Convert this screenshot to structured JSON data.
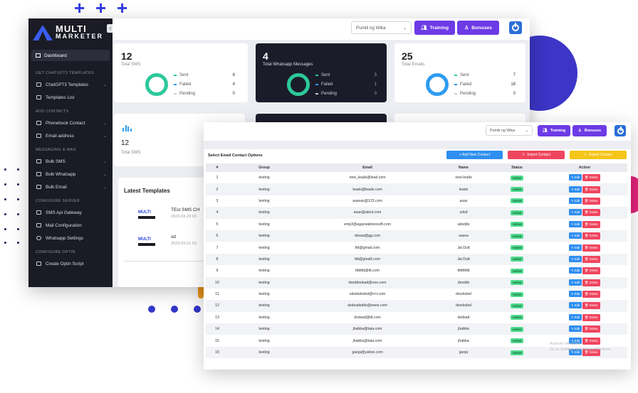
{
  "colors": {
    "accent": "#6d3be6",
    "sidebar": "#1a1b25",
    "success": "#2cc99a",
    "info": "#2d9cf0",
    "danger": "#f0455e",
    "warning": "#f5c518"
  },
  "brand": {
    "line1": "MULTI",
    "line2": "MARKETER"
  },
  "sidebar": {
    "active": "Dashboard",
    "sections": [
      {
        "title": "GET CHATGPT3 TEMPLATES",
        "items": [
          "ChatGPT3 Templates",
          "Templates List"
        ]
      },
      {
        "title": "ADD CONTACTS",
        "items": [
          "Phonebook Contact",
          "Email address"
        ]
      },
      {
        "title": "MESSAGING & MAIL",
        "items": [
          "Bulk SMS",
          "Bulk Whatsapp",
          "Bulk Email"
        ]
      },
      {
        "title": "CONFIGURE SERVER",
        "items": [
          "SMS Api Gateway",
          "Mail Configuration",
          "Whatsapp Settings"
        ]
      },
      {
        "title": "CONFIGURE OPTIN",
        "items": [
          "Create Optin Script"
        ]
      }
    ]
  },
  "header": {
    "language": "Pumili ng Wika",
    "training": "Training",
    "bonuses": "Bonuses"
  },
  "cards": [
    {
      "value": "12",
      "label": "Total SMS",
      "sent": "8",
      "failed": "4",
      "pending": "0"
    },
    {
      "value": "4",
      "label": "Total Whatsapp Messages",
      "sent": "3",
      "failed": "1",
      "pending": "0"
    },
    {
      "value": "25",
      "label": "Total Emails",
      "sent": "7",
      "failed": "18",
      "pending": "0"
    }
  ],
  "stat_labels": {
    "sent": "Sent",
    "failed": "Failed",
    "pending": "Pending"
  },
  "second_row": {
    "value": "12",
    "label": "Total SMS"
  },
  "latest": {
    "title": "Latest Templates",
    "items": [
      {
        "thumb": "MULTI",
        "name": "TEst SMS CH",
        "date": "2023-03-23 03"
      },
      {
        "thumb": "MULTI",
        "name": "sd",
        "date": "2023-03-21 03"
      }
    ]
  },
  "contacts": {
    "title": "Select Email Contact Options",
    "add": "+ Add New Contact",
    "import": "Import Contact",
    "export": "Export Contact",
    "columns": [
      "#",
      "Group",
      "Email",
      "Name",
      "Status",
      "Action"
    ],
    "status": "Active",
    "edit": "Edit",
    "delete": "Delete",
    "rows": [
      [
        "1",
        "testing",
        "new_leads@lead.com",
        "new leads"
      ],
      [
        "2",
        "testing",
        "leads@leads.com",
        "leads"
      ],
      [
        "3",
        "testing",
        "asasas@123.com",
        "asas"
      ],
      [
        "4",
        "testing",
        "asas@abcd.com",
        "sdsd"
      ],
      [
        "5",
        "testing",
        "emp3@agarwalinnosoft.com",
        "adsdds"
      ],
      [
        "6",
        "testing",
        "dssaa@gg.com",
        "sassa"
      ],
      [
        "7",
        "testing",
        "tttt@gmail.com",
        "Jai Dutt"
      ],
      [
        "8",
        "testing",
        "tttt@gmaill.com",
        "Jai Dutt"
      ],
      [
        "9",
        "testing",
        "ttttttttt@ttt.com",
        "tttttttttttt"
      ],
      [
        "10",
        "testing",
        "dssddsdsad@ooo.com",
        "dssdds"
      ],
      [
        "11",
        "testing",
        "sdsdsdsdsd@rrrr.com",
        "dssdsdsd"
      ],
      [
        "12",
        "testing",
        "dsdsadsdds@eeee.com",
        "dssdsdsd"
      ],
      [
        "13",
        "testing",
        "dsdsad@ttt.com",
        "dsdsad"
      ],
      [
        "14",
        "testing",
        "jhabba@tata.com",
        "jhabba"
      ],
      [
        "15",
        "testing",
        "jhabba@tata.com",
        "jhabba"
      ],
      [
        "16",
        "testing",
        "ganja@yahoo.com",
        "ganja"
      ]
    ]
  },
  "watermark": [
    "Activate Windows",
    "Go to Settings to activate Windows."
  ]
}
